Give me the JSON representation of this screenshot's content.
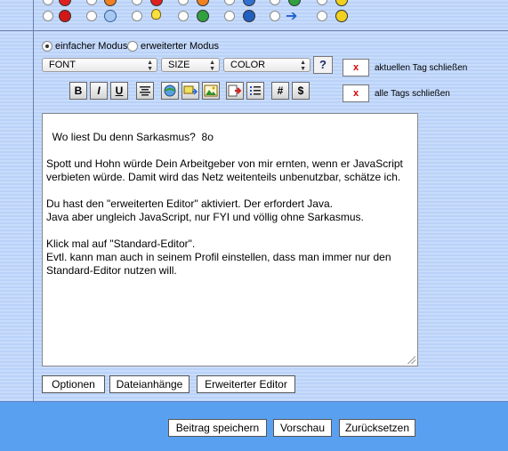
{
  "smileys": {
    "row1": [
      "smiley-red",
      "smiley-orange",
      "smiley-red-sad",
      "smiley-orange-2",
      "smiley-blue",
      "smiley-green",
      "smiley-yellow"
    ],
    "row2": [
      "smiley-red-angry",
      "smiley-blue-face",
      "lightbulb",
      "smiley-green-teeth",
      "smiley-blue-question",
      "arrow-right",
      "smiley-yellow-grin"
    ]
  },
  "mode": {
    "simple": "einfacher Modus",
    "advanced": "erweiterter Modus",
    "selected": "simple"
  },
  "selects": {
    "font": "FONT",
    "size": "SIZE",
    "color": "COLOR"
  },
  "help": {
    "icon": "?",
    "icon_name": "help-cursor-icon"
  },
  "close_tags": {
    "current_label": "aktuellen Tag schließen",
    "all_label": "alle Tags schließen",
    "x_symbol": "x"
  },
  "toolbar": {
    "bold": "B",
    "italic": "I",
    "underline": "U",
    "hash": "#",
    "dollar": "$"
  },
  "editor": {
    "text": "Wo liest Du denn Sarkasmus?  8o\n\nSpott und Hohn würde Dein Arbeitgeber von mir ernten, wenn er JavaScript verbieten würde. Damit wird das Netz weitenteils unbenutzbar, schätze ich.\n\nDu hast den \"erweiterten Editor\" aktiviert. Der erfordert Java.\nJava aber ungleich JavaScript, nur FYI und völlig ohne Sarkasmus.\n\nKlick mal auf \"Standard-Editor\".\nEvtl. kann man auch in seinem Profil einstellen, dass man immer nur den Standard-Editor nutzen will."
  },
  "editor_buttons": {
    "options": "Optionen",
    "attachments": "Dateianhänge",
    "advanced_editor": "Erweiterter Editor"
  },
  "form_buttons": {
    "save": "Beitrag speichern",
    "preview": "Vorschau",
    "reset": "Zurücksetzen"
  },
  "colors": {
    "background": "#c8dcfb",
    "bottom_bar": "#5aa0f0",
    "close_x": "#dd0000"
  }
}
